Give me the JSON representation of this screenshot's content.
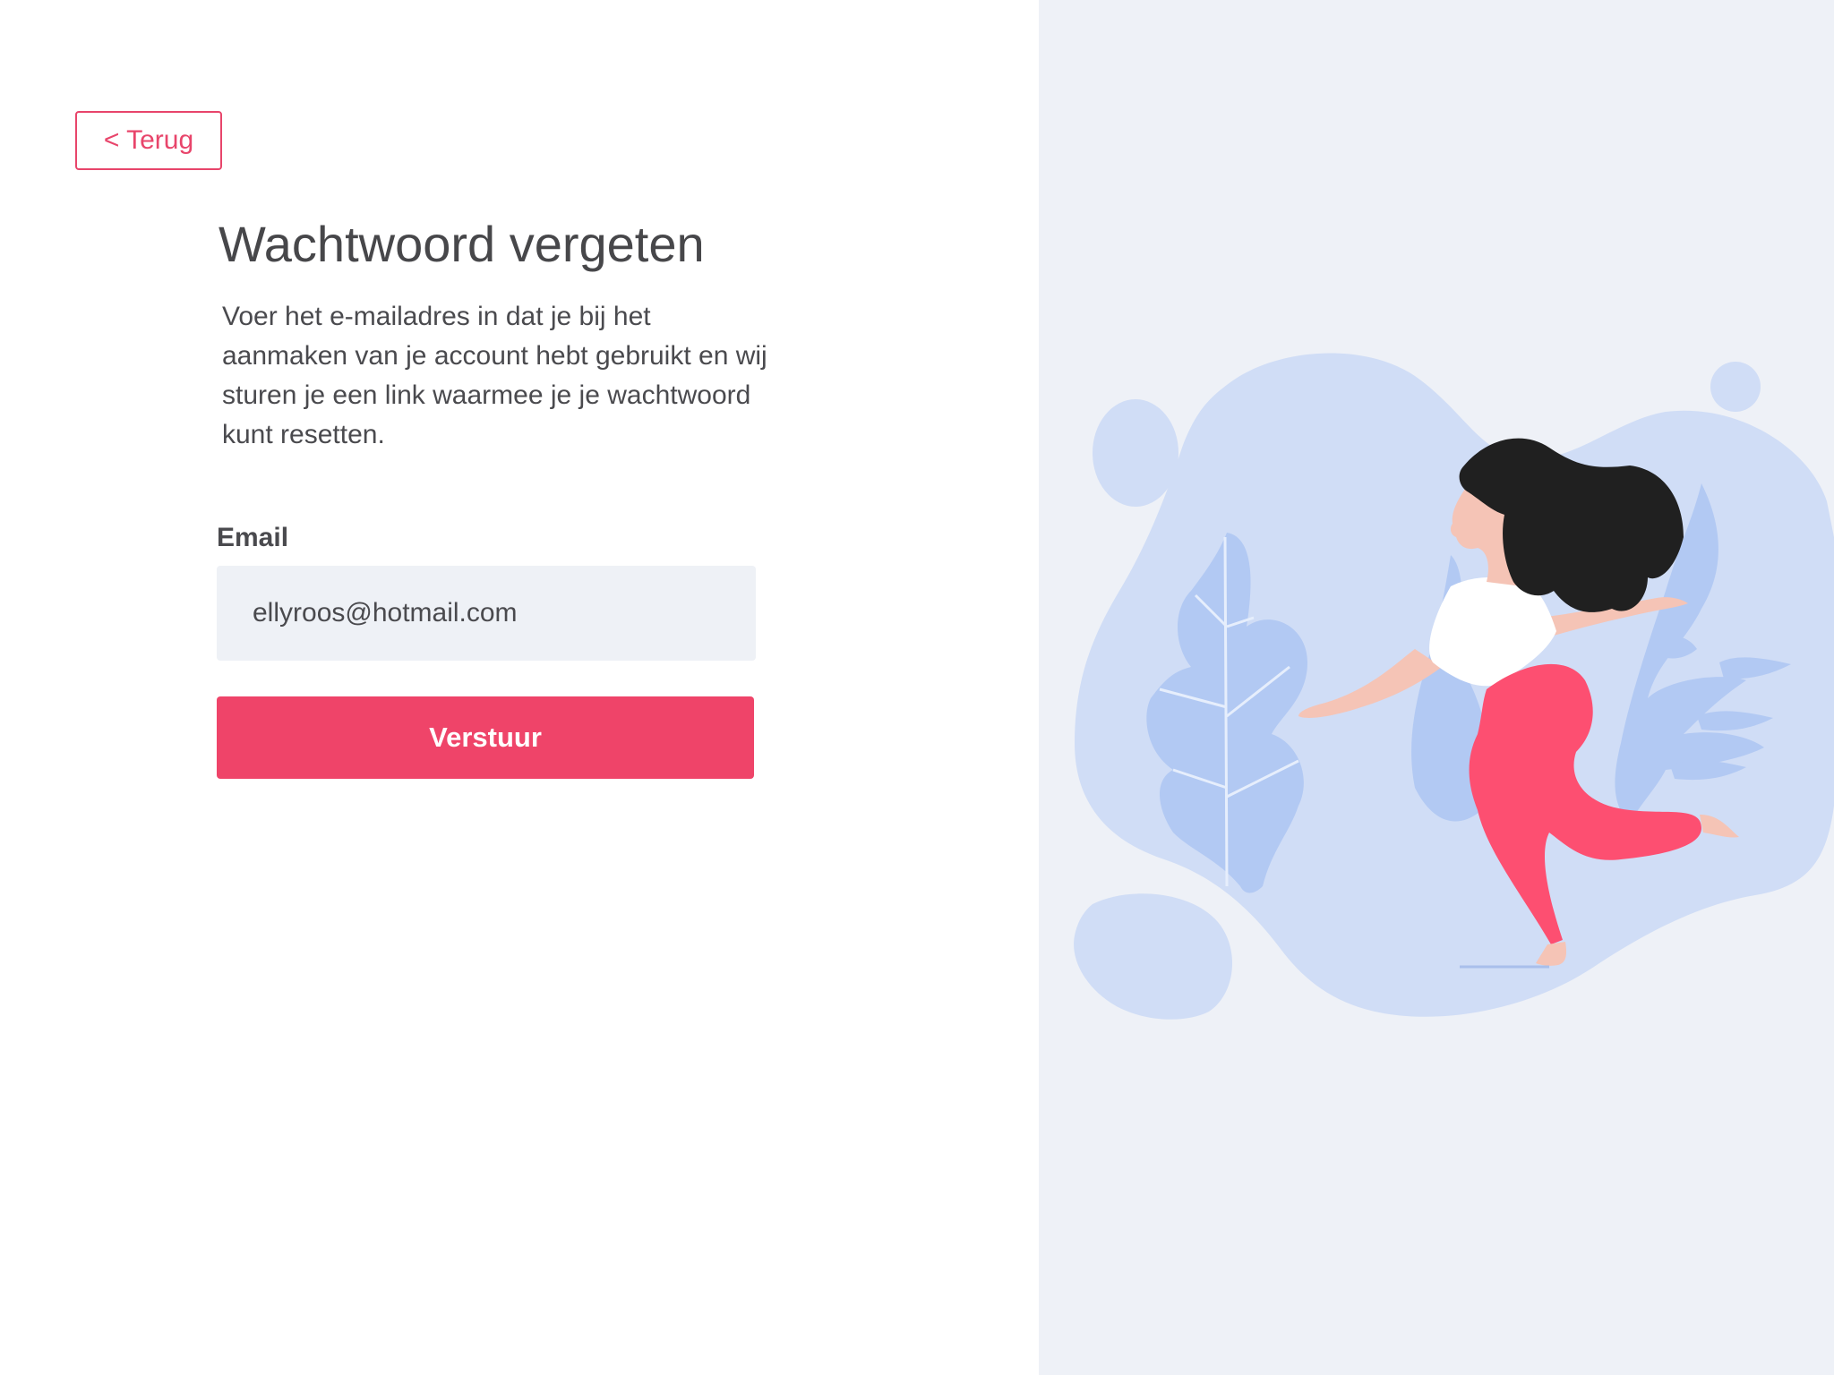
{
  "back": {
    "label": "< Terug"
  },
  "form": {
    "title": "Wachtwoord vergeten",
    "description": "Voer het e-mailadres in dat je bij het aanmaken van je account hebt gebruikt en wij sturen je een link waarmee je je wachtwoord kunt resetten.",
    "email_label": "Email",
    "email_value": "ellyroos@hotmail.com",
    "submit_label": "Verstuur"
  },
  "colors": {
    "accent": "#ef4469",
    "panel_bg": "#eef1f7",
    "blob": "#d0ddf6",
    "leaf": "#b2c9f3",
    "text": "#47474a"
  },
  "illustration": {
    "icon": "woman-running-illustration"
  }
}
